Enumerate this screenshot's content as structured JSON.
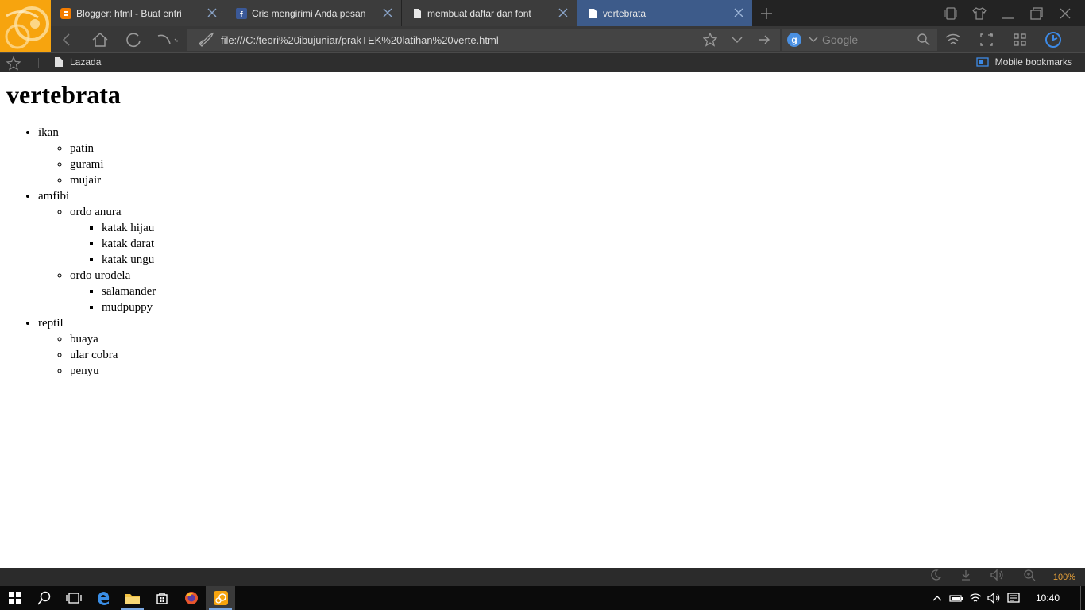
{
  "browser": {
    "tabs": [
      {
        "label": "Blogger: html - Buat entri",
        "icon": "blogger-icon",
        "active": false
      },
      {
        "label": "Cris mengirimi Anda pesan",
        "icon": "facebook-icon",
        "active": false
      },
      {
        "label": "membuat daftar dan font",
        "icon": "page-icon",
        "active": false
      },
      {
        "label": "vertebrata",
        "icon": "page-icon",
        "active": true
      }
    ],
    "url": "file:///C:/teori%20ibujuniar/prakTEK%20latihan%20verte.html",
    "search_placeholder": "Google",
    "search_engine_badge": "g",
    "bookmarks": [
      {
        "label": "Lazada"
      }
    ],
    "mobile_bookmarks": "Mobile bookmarks",
    "zoom": "100%",
    "accent_color": "#3d5b8a",
    "logo_color": "#f7a40e"
  },
  "page": {
    "title": "vertebrata",
    "groups": [
      {
        "label": "ikan",
        "children": [
          {
            "label": "patin"
          },
          {
            "label": "gurami"
          },
          {
            "label": "mujair"
          }
        ]
      },
      {
        "label": "amfibi",
        "children": [
          {
            "label": "ordo anura",
            "children": [
              "katak hijau",
              "katak darat",
              "katak ungu"
            ]
          },
          {
            "label": "ordo urodela",
            "children": [
              "salamander",
              "mudpuppy"
            ]
          }
        ]
      },
      {
        "label": "reptil",
        "children": [
          {
            "label": "buaya"
          },
          {
            "label": "ular cobra"
          },
          {
            "label": "penyu"
          }
        ]
      }
    ]
  },
  "taskbar": {
    "clock": "10:40"
  }
}
